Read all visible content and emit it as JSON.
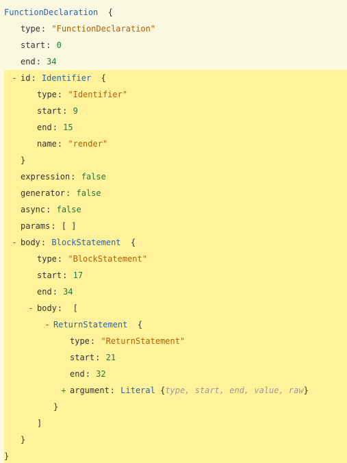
{
  "ast": {
    "functionDeclaration": {
      "ctor": "FunctionDeclaration",
      "open": "{",
      "close": "}",
      "props": {
        "type": {
          "key": "type",
          "value": "\"FunctionDeclaration\""
        },
        "start": {
          "key": "start",
          "value": "0"
        },
        "end": {
          "key": "end",
          "value": "34"
        }
      },
      "id": {
        "toggle": "-",
        "key": "id",
        "ctor": "Identifier",
        "open": "{",
        "close": "}",
        "props": {
          "type": {
            "key": "type",
            "value": "\"Identifier\""
          },
          "start": {
            "key": "start",
            "value": "9"
          },
          "end": {
            "key": "end",
            "value": "15"
          },
          "name": {
            "key": "name",
            "value": "\"render\""
          }
        }
      },
      "flags": {
        "expression": {
          "key": "expression",
          "value": "false"
        },
        "generator": {
          "key": "generator",
          "value": "false"
        },
        "async": {
          "key": "async",
          "value": "false"
        }
      },
      "params": {
        "key": "params",
        "open": "[",
        "close": "]"
      },
      "body": {
        "toggle": "-",
        "key": "body",
        "ctor": "BlockStatement",
        "open": "{",
        "close": "}",
        "props": {
          "type": {
            "key": "type",
            "value": "\"BlockStatement\""
          },
          "start": {
            "key": "start",
            "value": "17"
          },
          "end": {
            "key": "end",
            "value": "34"
          }
        },
        "innerBody": {
          "toggle": "-",
          "key": "body",
          "open": "[",
          "close": "]",
          "items": [
            {
              "toggle": "-",
              "ctor": "ReturnStatement",
              "open": "{",
              "close": "}",
              "props": {
                "type": {
                  "key": "type",
                  "value": "\"ReturnStatement\""
                },
                "start": {
                  "key": "start",
                  "value": "21"
                },
                "end": {
                  "key": "end",
                  "value": "32"
                }
              },
              "argument": {
                "toggle": "+",
                "key": "argument",
                "ctor": "Literal",
                "open": "{",
                "close": "}",
                "collapsedKeys": "type, start, end, value, raw"
              }
            }
          ]
        }
      }
    }
  }
}
